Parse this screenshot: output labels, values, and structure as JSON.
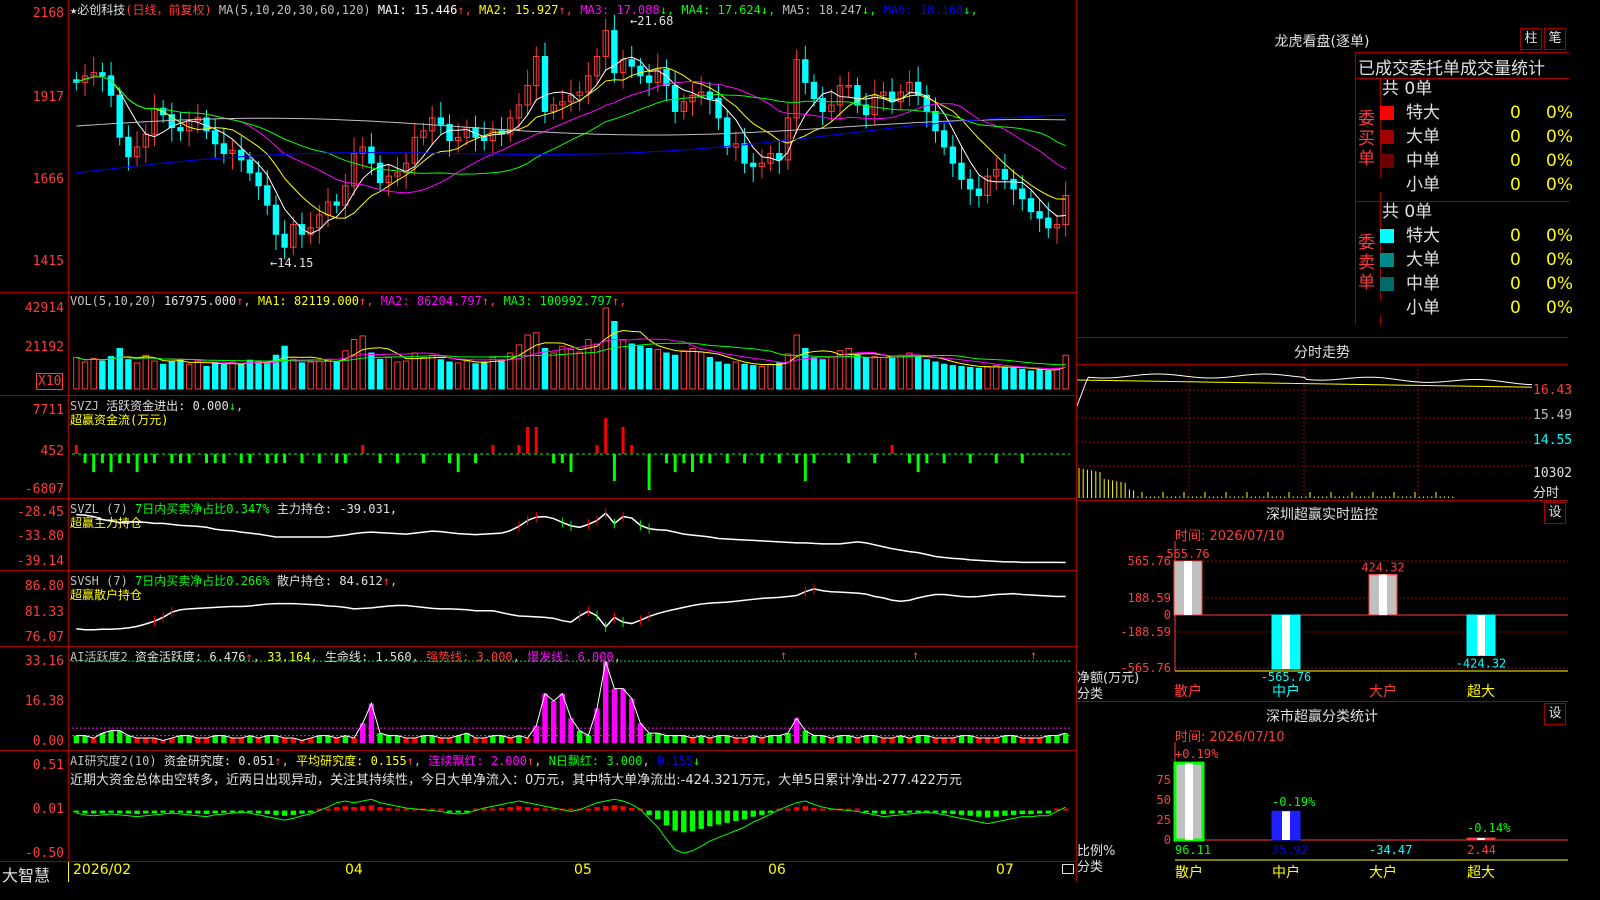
{
  "stock": {
    "name": "★必创科技",
    "period": "(日线，前复权)"
  },
  "kline": {
    "ma_params": "MA(5,10,20,30,60,120)",
    "ma": [
      {
        "label": "MA1:",
        "value": "15.446",
        "arrow": "↑",
        "color": "#ffffff"
      },
      {
        "label": "MA2:",
        "value": "15.927",
        "arrow": "↑",
        "color": "#ffff00"
      },
      {
        "label": "MA3:",
        "value": "17.088",
        "arrow": "↓",
        "color": "#ff00ff"
      },
      {
        "label": "MA4:",
        "value": "17.624",
        "arrow": "↓",
        "color": "#00ff00"
      },
      {
        "label": "MA5:",
        "value": "18.247",
        "arrow": "↓",
        "color": "#c0c0c0"
      },
      {
        "label": "MA6:",
        "value": "18.160",
        "arrow": "↓",
        "color": "#0000ff"
      }
    ],
    "yticks": [
      "2168",
      "1917",
      "1666",
      "1415"
    ],
    "high_label": "21.68",
    "low_label": "14.15",
    "prices": [
      19.7,
      19.9,
      20.0,
      19.9,
      19.3,
      18.0,
      17.4,
      17.7,
      18.1,
      18.9,
      18.7,
      18.3,
      18.2,
      18.5,
      18.6,
      18.2,
      17.8,
      17.5,
      17.6,
      17.3,
      16.9,
      16.5,
      15.9,
      15.0,
      14.6,
      15.3,
      15.0,
      15.2,
      15.6,
      16.0,
      15.9,
      16.5,
      17.5,
      17.7,
      17.2,
      16.6,
      16.8,
      16.9,
      17.2,
      18.0,
      18.2,
      18.6,
      18.4,
      17.9,
      18.0,
      18.3,
      18.0,
      17.9,
      18.2,
      18.1,
      18.6,
      19.0,
      19.6,
      20.5,
      18.8,
      19.0,
      19.1,
      19.3,
      19.4,
      19.9,
      20.5,
      21.3,
      20.0,
      20.4,
      20.2,
      19.9,
      19.7,
      20.1,
      19.6,
      18.8,
      19.1,
      19.3,
      19.4,
      19.2,
      18.6,
      17.7,
      17.8,
      17.2,
      17.1,
      17.2,
      17.5,
      17.3,
      18.6,
      20.4,
      19.7,
      19.2,
      18.8,
      19.0,
      19.6,
      19.6,
      19.0,
      18.7,
      19.3,
      19.4,
      19.1,
      19.4,
      19.7,
      19.3,
      18.8,
      18.2,
      17.7,
      17.2,
      16.7,
      16.4,
      16.2,
      16.8,
      17.0,
      16.7,
      16.4,
      16.1,
      15.7,
      15.5,
      15.2,
      15.3,
      16.2
    ]
  },
  "vol": {
    "params": "VOL(5,10,20)",
    "cur": {
      "value": "167975.000",
      "arrow": "↑"
    },
    "ma": [
      {
        "label": "MA1:",
        "value": "82119.000",
        "arrow": "↑",
        "color": "#ffff00"
      },
      {
        "label": "MA2:",
        "value": "86204.797",
        "arrow": "↑",
        "color": "#ff00ff"
      },
      {
        "label": "MA3:",
        "value": "100992.797",
        "arrow": "↑",
        "color": "#00ff00"
      }
    ],
    "yticks": [
      "42914",
      "21192"
    ],
    "unit": "X10",
    "values": [
      70,
      60,
      68,
      62,
      72,
      90,
      65,
      58,
      75,
      62,
      55,
      60,
      64,
      55,
      62,
      50,
      58,
      54,
      60,
      55,
      64,
      60,
      58,
      75,
      95,
      66,
      58,
      60,
      62,
      65,
      60,
      85,
      110,
      118,
      80,
      66,
      70,
      60,
      62,
      80,
      70,
      75,
      65,
      60,
      58,
      62,
      56,
      60,
      70,
      65,
      80,
      98,
      120,
      125,
      90,
      80,
      95,
      88,
      82,
      110,
      100,
      180,
      150,
      110,
      100,
      95,
      90,
      88,
      80,
      75,
      85,
      90,
      82,
      70,
      60,
      55,
      60,
      55,
      52,
      50,
      55,
      58,
      78,
      120,
      90,
      70,
      65,
      72,
      85,
      90,
      75,
      70,
      72,
      70,
      68,
      75,
      80,
      72,
      65,
      60,
      55,
      52,
      50,
      48,
      46,
      50,
      52,
      48,
      46,
      44,
      40,
      42,
      40,
      46,
      75
    ]
  },
  "svzj": {
    "title": "SVZJ",
    "label": "活跃资金进出:",
    "value": "0.000",
    "arrow": "↓",
    "sub": "超赢资金流(万元)",
    "yticks": [
      "7711",
      "452",
      "-6807"
    ],
    "values": [
      1,
      -1,
      -2,
      -1,
      -2,
      -1,
      -1,
      -2,
      -1,
      -1,
      0,
      -1,
      -1,
      -1,
      0,
      -1,
      -1,
      -1,
      0,
      -1,
      -1,
      0,
      -1,
      -1,
      -1,
      0,
      -1,
      0,
      -1,
      0,
      -1,
      -1,
      0,
      1,
      0,
      -1,
      0,
      -1,
      0,
      0,
      -1,
      0,
      0,
      -1,
      -2,
      0,
      -1,
      0,
      1,
      0,
      0,
      1,
      3,
      3,
      0,
      -1,
      -1,
      -2,
      0,
      0,
      1,
      4,
      -3,
      3,
      1,
      0,
      -4,
      0,
      -1,
      -2,
      -1,
      -2,
      -1,
      -1,
      0,
      -1,
      0,
      -1,
      0,
      -1,
      0,
      -1,
      0,
      -1,
      -3,
      -1,
      0,
      0,
      0,
      -1,
      0,
      0,
      -1,
      0,
      1,
      0,
      -1,
      -2,
      -1,
      0,
      -1,
      0,
      0,
      -1,
      0,
      0,
      -1,
      0,
      0,
      -1,
      0,
      0,
      0,
      0,
      0,
      0
    ]
  },
  "svzl": {
    "title": "SVZL",
    "params": "(7)",
    "desc": "7日内买卖净占比0.347%",
    "label": "主力持仓:",
    "value": "-39.031,",
    "sub": "超赢主力持仓",
    "yticks": [
      "-28.45",
      "-33.80",
      "-39.14"
    ],
    "values": [
      -29.2,
      -29.3,
      -29.6,
      -30.2,
      -30.5,
      -30.8,
      -30.7,
      -30.7,
      -30.8,
      -31.0,
      -31.0,
      -31.2,
      -31.4,
      -31.5,
      -31.6,
      -31.8,
      -32.2,
      -32.4,
      -32.5,
      -32.8,
      -33.0,
      -33.2,
      -33.5,
      -33.8,
      -33.8,
      -33.8,
      -33.8,
      -33.8,
      -33.8,
      -33.8,
      -33.6,
      -33.4,
      -33.1,
      -32.9,
      -32.8,
      -32.9,
      -33.0,
      -33.1,
      -33.2,
      -33.0,
      -32.8,
      -32.6,
      -32.7,
      -32.9,
      -33.1,
      -33.2,
      -33.3,
      -33.2,
      -33.1,
      -33.0,
      -32.5,
      -31.6,
      -30.4,
      -29.7,
      -29.6,
      -30.0,
      -30.8,
      -31.5,
      -31.8,
      -31.2,
      -30.4,
      -28.9,
      -31.0,
      -29.6,
      -29.9,
      -31.4,
      -32.1,
      -32.3,
      -32.4,
      -32.8,
      -33.2,
      -33.4,
      -33.6,
      -33.8,
      -34.1,
      -34.2,
      -34.3,
      -34.4,
      -34.5,
      -34.6,
      -34.7,
      -34.8,
      -34.9,
      -35.0,
      -35.0,
      -35.1,
      -35.2,
      -35.2,
      -35.2,
      -35.0,
      -34.8,
      -35.0,
      -35.4,
      -35.8,
      -36.2,
      -36.5,
      -36.8,
      -37.0,
      -37.4,
      -37.8,
      -38.0,
      -38.2,
      -38.3,
      -38.5,
      -38.6,
      -38.7,
      -38.8,
      -38.9,
      -38.9,
      -39.0,
      -39.0,
      -39.0,
      -39.0,
      -39.0,
      -39.03
    ]
  },
  "svsh": {
    "title": "SVSH",
    "params": "(7)",
    "desc": "7日内买卖净占比0.266%",
    "label": "散户持仓:",
    "value": "84.612",
    "arrow": "↑",
    "sub": "超赢散户持仓",
    "yticks": [
      "86.80",
      "81.33",
      "76.07"
    ],
    "values": [
      77.8,
      77.6,
      77.6,
      77.7,
      77.7,
      77.8,
      78.0,
      78.3,
      78.8,
      79.4,
      80.2,
      81.3,
      81.8,
      82.0,
      82.1,
      82.2,
      82.3,
      82.4,
      82.5,
      82.5,
      82.6,
      82.8,
      83.0,
      83.1,
      83.1,
      83.1,
      83.0,
      82.9,
      82.8,
      82.6,
      82.5,
      82.3,
      82.0,
      82.1,
      82.2,
      82.4,
      82.6,
      82.7,
      82.7,
      82.5,
      82.3,
      82.1,
      82.0,
      82.0,
      81.9,
      81.8,
      81.6,
      81.6,
      81.6,
      81.2,
      80.8,
      80.5,
      80.4,
      80.3,
      80.2,
      80.0,
      79.5,
      79.2,
      80.5,
      81.5,
      80.5,
      78.2,
      80.2,
      79.2,
      78.9,
      79.6,
      80.4,
      81.0,
      81.5,
      81.9,
      82.3,
      82.7,
      83.0,
      83.2,
      83.3,
      83.4,
      83.6,
      83.8,
      84.0,
      84.2,
      84.3,
      84.4,
      84.6,
      84.8,
      85.6,
      86.2,
      85.8,
      85.6,
      85.5,
      85.4,
      85.3,
      85.1,
      84.6,
      84.3,
      83.8,
      83.6,
      83.8,
      84.3,
      84.7,
      85.0,
      85.0,
      84.8,
      84.6,
      84.5,
      84.6,
      84.8,
      85.0,
      85.1,
      85.2,
      85.0,
      84.9,
      84.8,
      84.7,
      84.6,
      84.61
    ]
  },
  "ai_active": {
    "title": "AI活跃度2",
    "label": "资金活跃度:",
    "value": "6.476",
    "arrow": "↑",
    "avg": "33.164",
    "life_label": "生命线:",
    "life": "1.560",
    "strong_label": "强势线:",
    "strong": "3.000",
    "burst_label": "爆发线:",
    "burst": "6.000",
    "yticks": [
      "33.16",
      "16.38",
      "0.00"
    ],
    "values": [
      3,
      3,
      2,
      4,
      5,
      5,
      3,
      2,
      2,
      2,
      1,
      2,
      3,
      3,
      2,
      2,
      3,
      3,
      2,
      2,
      3,
      2,
      3,
      3,
      2,
      2,
      1,
      2,
      3,
      3,
      2,
      3,
      2,
      8,
      16,
      4,
      3,
      3,
      2,
      2,
      3,
      3,
      2,
      2,
      3,
      4,
      2,
      2,
      3,
      3,
      2,
      3,
      2,
      7,
      20,
      17,
      20,
      10,
      5,
      3,
      14,
      33,
      22,
      22,
      18,
      8,
      4,
      4,
      3,
      3,
      3,
      2,
      3,
      2,
      3,
      3,
      2,
      2,
      3,
      2,
      3,
      3,
      4,
      10,
      5,
      3,
      3,
      2,
      3,
      3,
      2,
      3,
      3,
      2,
      2,
      3,
      2,
      3,
      3,
      2,
      2,
      2,
      3,
      3,
      2,
      2,
      2,
      3,
      3,
      2,
      2,
      2,
      3,
      3,
      4
    ]
  },
  "ai_research": {
    "title": "AI研究度2(10)",
    "label": "资金研究度:",
    "value": "0.051",
    "arrow": "↑",
    "avg_label": "平均研究度:",
    "avg": "0.155",
    "avg_arrow": "↑",
    "red_label": "连续飘红:",
    "red": "2.000",
    "red_arrow": "↑",
    "nred_label": "N日飘红:",
    "nred": "3.000",
    "nred_extra": "0.155",
    "nred_arrow": "↓",
    "comment": "近期大资金总体由空转多，近两日出现异动，关注其持续性，今日大单净流入：0万元，其中特大单净流出:-424.321万元，大单5日累计净出-277.422万元",
    "yticks": [
      "0.51",
      "0.01",
      "-0.50"
    ],
    "values": [
      -0.02,
      -0.04,
      -0.05,
      -0.04,
      -0.03,
      -0.04,
      -0.05,
      -0.06,
      -0.05,
      -0.04,
      -0.03,
      -0.02,
      -0.03,
      -0.04,
      -0.05,
      -0.06,
      -0.04,
      -0.03,
      -0.02,
      -0.01,
      -0.02,
      -0.04,
      -0.06,
      -0.08,
      -0.1,
      -0.08,
      -0.05,
      -0.03,
      0.01,
      0.05,
      0.1,
      0.12,
      0.1,
      0.12,
      0.14,
      0.1,
      0.08,
      0.06,
      0.04,
      0.03,
      0.02,
      0.01,
      0.0,
      -0.02,
      -0.03,
      -0.02,
      0.01,
      0.04,
      0.06,
      0.08,
      0.1,
      0.12,
      0.1,
      0.08,
      0.06,
      0.04,
      0.02,
      0.0,
      0.02,
      0.06,
      0.1,
      0.12,
      0.14,
      0.12,
      0.08,
      0.02,
      -0.08,
      -0.18,
      -0.32,
      -0.44,
      -0.48,
      -0.45,
      -0.4,
      -0.34,
      -0.3,
      -0.26,
      -0.22,
      -0.18,
      -0.12,
      -0.08,
      -0.03,
      0.02,
      0.06,
      0.1,
      0.12,
      0.08,
      0.05,
      0.03,
      0.02,
      0.01,
      0.0,
      -0.02,
      -0.04,
      -0.06,
      -0.05,
      -0.04,
      -0.03,
      -0.02,
      -0.01,
      -0.02,
      -0.04,
      -0.06,
      -0.08,
      -0.1,
      -0.12,
      -0.14,
      -0.12,
      -0.1,
      -0.08,
      -0.06,
      -0.06,
      -0.05,
      -0.05,
      0.0,
      0.05
    ]
  },
  "xaxis": {
    "brand": "大智慧",
    "labels": [
      "2026/02",
      "04",
      "05",
      "06",
      "07"
    ]
  },
  "lhb": {
    "title": "龙虎看盘(逐单)",
    "btn1": "柱",
    "btn2": "笔",
    "header": "已成交委托单成交量统计",
    "buy": {
      "side": "委买单",
      "total": "共 0单",
      "rows": [
        {
          "label": "特大",
          "v": "0",
          "p": "0%",
          "color": "#ff0000"
        },
        {
          "label": "大单",
          "v": "0",
          "p": "0%",
          "color": "#a00000"
        },
        {
          "label": "中单",
          "v": "0",
          "p": "0%",
          "color": "#700000"
        },
        {
          "label": "小单",
          "v": "0",
          "p": "0%",
          "color": "#000000"
        }
      ]
    },
    "sell": {
      "side": "委卖单",
      "total": "共 0单",
      "rows": [
        {
          "label": "特大",
          "v": "0",
          "p": "0%",
          "color": "#00ffff"
        },
        {
          "label": "大单",
          "v": "0",
          "p": "0%",
          "color": "#008a8a"
        },
        {
          "label": "中单",
          "v": "0",
          "p": "0%",
          "color": "#006a6a"
        },
        {
          "label": "小单",
          "v": "0",
          "p": "0%",
          "color": "#000000"
        }
      ]
    }
  },
  "intraday": {
    "title": "分时走势",
    "yticks": [
      "16.43",
      "15.49",
      "14.55"
    ],
    "vol_tick": "10302",
    "unit": "分时"
  },
  "sz_monitor": {
    "title": "深圳超赢实时监控",
    "btn": "设",
    "time_label": "时间:",
    "time": "2026/07/10",
    "yticks": [
      "565.76",
      "188.59",
      "0",
      "-188.59",
      "-565.76"
    ],
    "bar_labels": [
      "565.76",
      "-565.76",
      "424.32",
      "-424.32"
    ],
    "unit": "净额(万元)",
    "cat_label": "分类",
    "cats": [
      "散户",
      "中户",
      "大户",
      "超大"
    ]
  },
  "sz_stats": {
    "title": "深市超赢分类统计",
    "btn": "设",
    "time_label": "时间:",
    "time": "2026/07/10",
    "yticks": [
      "75",
      "50",
      "25",
      "0"
    ],
    "pct_labels": [
      "+0.19%",
      "-0.19%",
      "-0.14%"
    ],
    "values": [
      "96.11",
      "35.92",
      "-34.47",
      "2.44"
    ],
    "unit": "比例%",
    "cat_label": "分类",
    "cats": [
      "散户",
      "中户",
      "大户",
      "超大"
    ]
  }
}
